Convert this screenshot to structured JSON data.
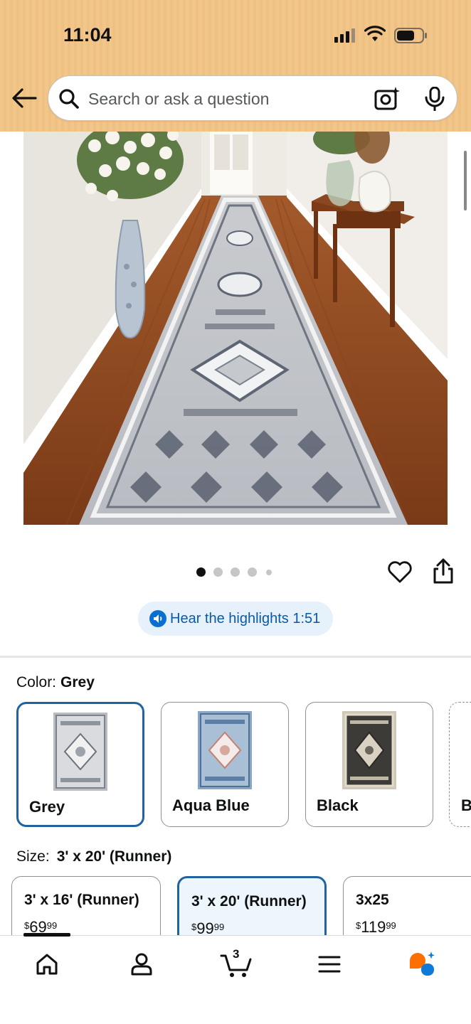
{
  "status_bar": {
    "time": "11:04"
  },
  "search": {
    "placeholder": "Search or ask a question"
  },
  "gallery": {
    "image_count": 5,
    "active_index": 0
  },
  "highlights": {
    "label": "Hear the highlights 1:51"
  },
  "color": {
    "label": "Color:",
    "selected": "Grey",
    "options": [
      {
        "name": "Grey",
        "swatch": "#9ea2a6"
      },
      {
        "name": "Aqua Blue",
        "swatch": "#7f9fc0"
      },
      {
        "name": "Black",
        "swatch": "#3a3a38"
      },
      {
        "name": "B"
      }
    ]
  },
  "size": {
    "label": "Size:",
    "selected": "3' x 20' (Runner)",
    "options": [
      {
        "name": "3' x 16' (Runner)",
        "currency": "$",
        "whole": "69",
        "fraction": "99"
      },
      {
        "name": "3' x 20' (Runner)",
        "currency": "$",
        "whole": "99",
        "fraction": "99"
      },
      {
        "name": "3x25",
        "currency": "$",
        "whole": "119",
        "fraction": "99"
      }
    ]
  },
  "bottom_nav": {
    "items": [
      "home-icon",
      "account-icon",
      "cart-icon",
      "menu-icon",
      "rufus-icon"
    ],
    "cart_count": "3"
  },
  "colors": {
    "header_bg": "#f2c589",
    "selected_border": "#2162a1",
    "link_blue": "#0a5aa5",
    "rufus_orange": "#ff6f00",
    "rufus_blue": "#0f7bd8"
  }
}
